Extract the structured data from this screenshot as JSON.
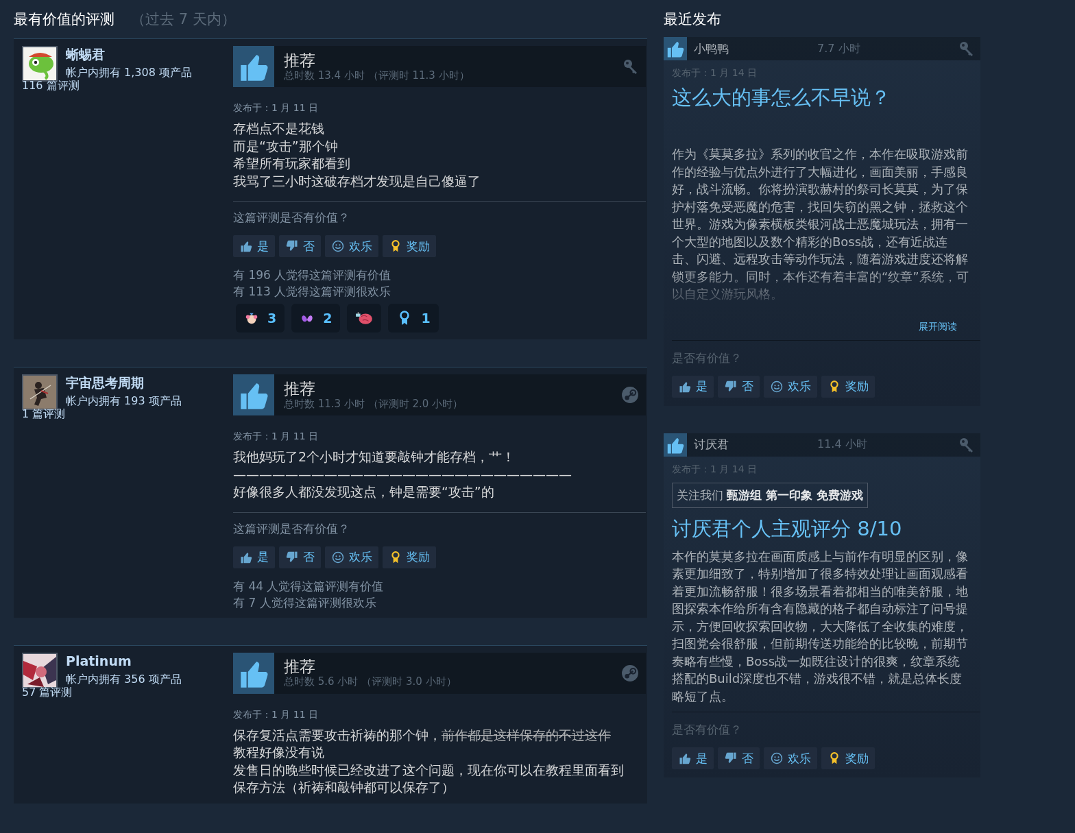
{
  "helpful": {
    "title": "最有价值的评测",
    "period": "（过去 7 天内）",
    "reviews": [
      {
        "author": "蜥蜴君",
        "owned": "帐户内拥有 1,308 项产品",
        "review_count": "116 篇评测",
        "verdict": "推荐",
        "hours": "总时数 13.4 小时 （评测时 11.3 小时）",
        "kind": "key",
        "date": "发布于：1 月 11 日",
        "lines": [
          [
            {
              "text": "存档点不是花钱"
            }
          ],
          [
            {
              "text": "而是“攻击”那个钟"
            }
          ],
          [
            {
              "text": "希望所有玩家都看到"
            }
          ],
          [
            {
              "text": "我骂了三小时这破存档才发现是自己傻逼了"
            }
          ]
        ],
        "question": "这篇评测是否有价值？",
        "buttons": [
          {
            "kind": "yes",
            "label": "是"
          },
          {
            "kind": "no",
            "label": "否"
          },
          {
            "kind": "funny",
            "label": "欢乐"
          },
          {
            "kind": "award",
            "label": "奖励"
          }
        ],
        "stats": [
          "有 196 人觉得这篇评测有价值",
          "有 113 人觉得这篇评测很欢乐"
        ],
        "reactions": [
          {
            "kind": "head",
            "count": "3"
          },
          {
            "kind": "wings",
            "count": "2"
          },
          {
            "kind": "brain"
          },
          {
            "kind": "ribbon",
            "count": "1"
          }
        ]
      },
      {
        "author": "宇宙思考周期",
        "owned": "帐户内拥有 193 项产品",
        "review_count": "1 篇评测",
        "verdict": "推荐",
        "hours": "总时数 11.3 小时 （评测时 2.0 小时）",
        "kind": "steam",
        "date": "发布于：1 月 11 日",
        "lines": [
          [
            {
              "text": "我他妈玩了2个小时才知道要敲钟才能存档，艹！"
            }
          ],
          [
            {
              "text": "——————————————————————————"
            }
          ],
          [
            {
              "text": "好像很多人都没发现这点，钟是需要“攻击”的"
            }
          ]
        ],
        "question": "这篇评测是否有价值？",
        "buttons": [
          {
            "kind": "yes",
            "label": "是"
          },
          {
            "kind": "no",
            "label": "否"
          },
          {
            "kind": "funny",
            "label": "欢乐"
          },
          {
            "kind": "award",
            "label": "奖励"
          }
        ],
        "stats": [
          "有 44 人觉得这篇评测有价值",
          "有 7 人觉得这篇评测很欢乐"
        ]
      },
      {
        "author": "Platinum",
        "owned": "帐户内拥有 356 项产品",
        "review_count": "57 篇评测",
        "verdict": "推荐",
        "hours": "总时数 5.6 小时 （评测时 3.0 小时）",
        "kind": "steam",
        "date": "发布于：1 月 11 日",
        "lines": [
          [
            {
              "text": "保存复活点需要攻击祈祷的那个钟，",
              "struck": false
            },
            {
              "text": "前作都是这样保存的不过这作",
              "struck": true
            }
          ],
          [
            {
              "text": "教程好像没有说"
            }
          ],
          [
            {
              "text": "发售日的晚些时候已经改进了这个问题，现在你可以在教程里面看到"
            }
          ],
          [
            {
              "text": "保存方法（祈祷和敲钟都可以保存了）"
            }
          ]
        ]
      }
    ]
  },
  "recent": {
    "title": "最近发布",
    "reviews": [
      {
        "author": "小鸭鸭",
        "hours": "7.7 小时",
        "kind": "key",
        "date": "发布于：1 月 14 日",
        "heading": "这么大的事怎么不早说？",
        "body": "作为《莫莫多拉》系列的收官之作，本作在吸取游戏前作的经验与优点外进行了大幅进化，画面美丽，手感良好，战斗流畅。你将扮演歌赫村的祭司长莫莫，为了保护村落免受恶魔的危害，找回失窃的黑之钟，拯救这个世界。游戏为像素横板类银河战士恶魔城玩法，拥有一个大型的地图以及数个精彩的Boss战，还有近战连击、闪避、远程攻击等动作玩法，随着游戏进度还将解锁更多能力。同时，本作还有着丰富的“纹章”系统，可以自定义游玩风格。",
        "expand": "展开阅读",
        "question": "是否有价值？",
        "buttons": [
          {
            "kind": "yes",
            "label": "是"
          },
          {
            "kind": "no",
            "label": "否"
          },
          {
            "kind": "funny",
            "label": "欢乐"
          },
          {
            "kind": "award",
            "label": "奖励"
          }
        ]
      },
      {
        "author": "讨厌君",
        "hours": "11.4 小时",
        "kind": "key",
        "date": "发布于：1 月 14 日",
        "notice": "关注我们 **甄游组 第一印象 免费游戏**",
        "heading": "讨厌君个人主观评分 8/10",
        "body": "本作的莫莫多拉在画面质感上与前作有明显的区别，像素更加细致了，特别增加了很多特效处理让画面观感看着更加流畅舒服！很多场景看着都相当的唯美舒服，地图探索本作给所有含有隐藏的格子都自动标注了问号提示，方便回收探索回收物，大大降低了全收集的难度，扫图党会很舒服，但前期传送功能给的比较晚，前期节奏略有些慢，Boss战一如既往设计的很爽，纹章系统搭配的Build深度也不错，游戏很不错，就是总体长度略短了点。",
        "question": "是否有价值？",
        "buttons": [
          {
            "kind": "yes",
            "label": "是"
          },
          {
            "kind": "no",
            "label": "否"
          },
          {
            "kind": "funny",
            "label": "欢乐"
          },
          {
            "kind": "award",
            "label": "奖励"
          }
        ]
      }
    ]
  }
}
